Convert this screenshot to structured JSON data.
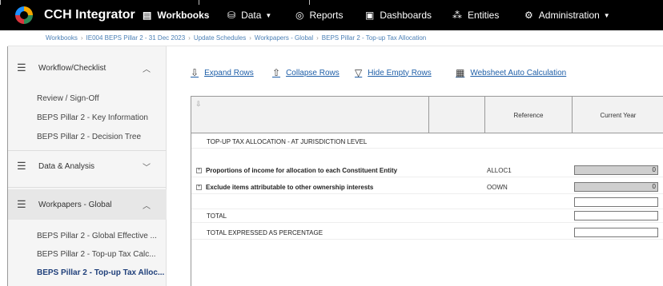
{
  "nav": {
    "app_name": "CCH Integrator",
    "items": [
      {
        "label": "Workbooks",
        "icon": "workbook-icon",
        "active": true
      },
      {
        "label": "Data",
        "icon": "database-icon",
        "dropdown": true
      },
      {
        "label": "Reports",
        "icon": "reports-icon"
      },
      {
        "label": "Dashboards",
        "icon": "dashboard-icon"
      },
      {
        "label": "Entities",
        "icon": "entities-icon"
      },
      {
        "label": "Administration",
        "icon": "gear-icon",
        "dropdown": true
      }
    ],
    "colors": {
      "bar": "#000000",
      "text": "#ffffff"
    }
  },
  "breadcrumb": [
    "Workbooks",
    "IE004 BEPS Pillar 2 - 31 Dec 2023",
    "Update Schedules",
    "Workpapers - Global",
    "BEPS Pillar 2 - Top-up Tax Allocation"
  ],
  "sidebar": {
    "sections": [
      {
        "label": "Workflow/Checklist",
        "icon": "layers-icon",
        "expanded": true,
        "items": [
          "Review / Sign-Off",
          "BEPS Pillar 2 - Key Information",
          "BEPS Pillar 2 - Decision Tree"
        ]
      },
      {
        "label": "Data & Analysis",
        "icon": "layers-icon",
        "expanded": false,
        "items": []
      },
      {
        "label": "Workpapers - Global",
        "icon": "layers-icon",
        "expanded": true,
        "items": [
          "BEPS Pillar 2 - Global Effective ...",
          "BEPS Pillar 2 - Top-up Tax Calc...",
          "BEPS Pillar 2 - Top-up Tax Alloc..."
        ],
        "active_item": "BEPS Pillar 2 - Top-up Tax Alloc..."
      }
    ]
  },
  "toolbar": {
    "expand_rows": "Expand Rows",
    "collapse_rows": "Collapse Rows",
    "hide_empty_rows": "Hide Empty Rows",
    "websheet_auto_calc": "Websheet Auto Calculation"
  },
  "grid": {
    "columns": {
      "reference": "Reference",
      "current_year": "Current Year"
    },
    "rows": [
      {
        "label": "TOP-UP TAX ALLOCATION - AT JURISDICTION LEVEL",
        "ref": "",
        "value": null,
        "bold": false,
        "expandable": false
      },
      {
        "label": "Proportions of income for allocation to each Constituent Entity",
        "ref": "ALLOC1",
        "value": "0",
        "bold": true,
        "expandable": true,
        "cell": "grey"
      },
      {
        "label": "Exclude items attributable to other ownership interests",
        "ref": "OOWN",
        "value": "0",
        "bold": true,
        "expandable": true,
        "cell": "grey"
      },
      {
        "label": "",
        "ref": "",
        "value": "",
        "bold": false,
        "expandable": false,
        "cell": "white"
      },
      {
        "label": "TOTAL",
        "ref": "",
        "value": "",
        "bold": false,
        "expandable": false,
        "cell": "white"
      },
      {
        "label": "TOTAL EXPRESSED AS PERCENTAGE",
        "ref": "",
        "value": "",
        "bold": false,
        "expandable": false,
        "cell": "white"
      }
    ]
  }
}
